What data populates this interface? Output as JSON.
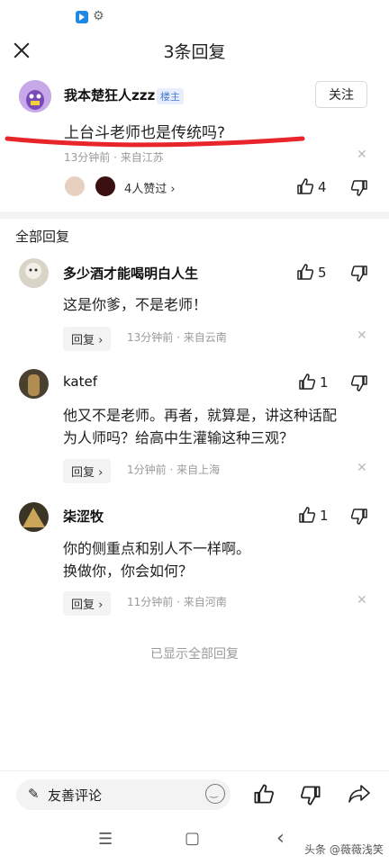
{
  "status_bar": {
    "app_icon": "blue-app-icon",
    "settings_icon": "gear-icon"
  },
  "header": {
    "title": "3条回复",
    "close_icon": "close-icon"
  },
  "op": {
    "username": "我本楚狂人zzz",
    "badge": "楼主",
    "follow_label": "关注",
    "text": "上台斗老师也是传统吗?",
    "meta": "13分钟前 · 来自江苏",
    "likers_label": "4人赞过 ›",
    "like_count": "4"
  },
  "section_title": "全部回复",
  "comments": [
    {
      "username": "多少酒才能喝明白人生",
      "likes": "5",
      "lines": [
        "这是你爹，不是老师！"
      ],
      "reply_label": "回复 ›",
      "meta": "13分钟前 · 来自云南"
    },
    {
      "username": "katef",
      "likes": "1",
      "lines": [
        "他又不是老师。再者，就算是，讲这种话配",
        "为人师吗？给高中生灌输这种三观？"
      ],
      "reply_label": "回复 ›",
      "meta": "1分钟前 · 来自上海"
    },
    {
      "username": "柒涩牧",
      "likes": "1",
      "lines": [
        "你的侧重点和别人不一样啊。",
        "换做你，你会如何？"
      ],
      "reply_label": "回复 ›",
      "meta": "11分钟前 · 来自河南"
    }
  ],
  "end_text": "已显示全部回复",
  "bottom": {
    "comment_placeholder": "友善评论"
  },
  "nav": {
    "menu": "☰",
    "home": "▢",
    "back": "‹"
  },
  "watermark": "头条 @薇薇浅笑",
  "colors": {
    "accent": "#4a7bd0",
    "annotation_red": "#e8252b",
    "muted": "#9a9a9a"
  }
}
